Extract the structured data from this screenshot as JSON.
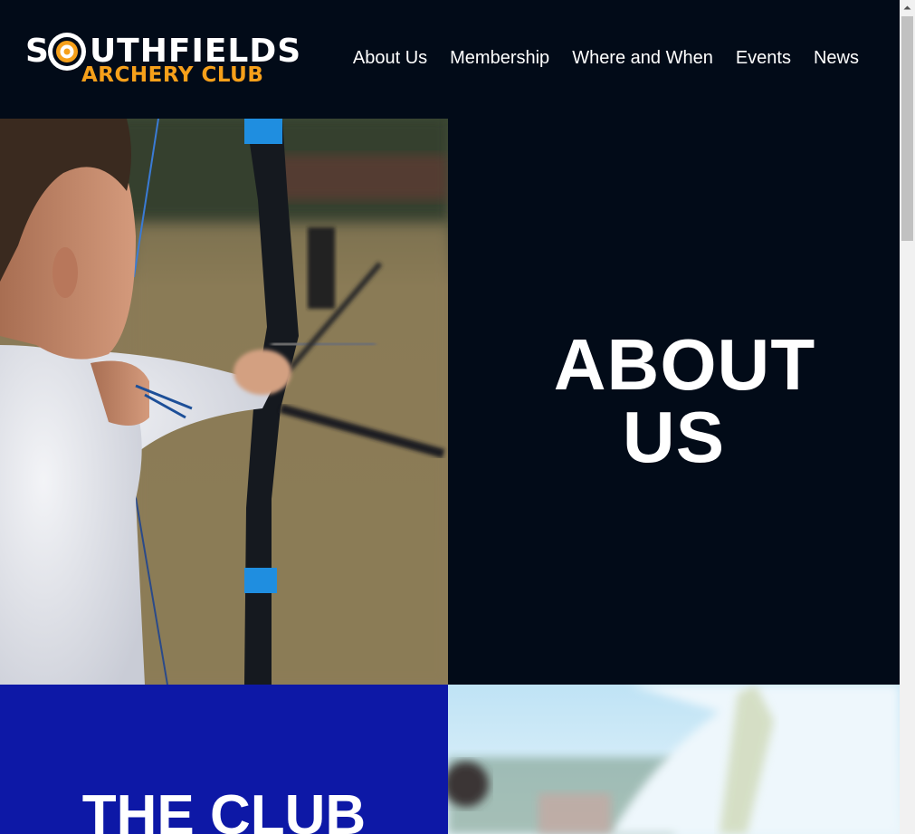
{
  "site": {
    "logo_line1": "SOUTHFIELDS",
    "logo_line1_lead": "S",
    "logo_line1_rest": "UTHFIELDS",
    "logo_line2": "ARCHERY CLUB"
  },
  "nav": {
    "items": [
      {
        "label": "About Us"
      },
      {
        "label": "Membership"
      },
      {
        "label": "Where and When"
      },
      {
        "label": "Events"
      },
      {
        "label": "News"
      }
    ]
  },
  "hero": {
    "title_line1": "ABOUT",
    "title_line2": "US"
  },
  "club_section": {
    "title": "THE CLUB"
  },
  "colors": {
    "navy": "#020b18",
    "brand_blue": "#0d18a6",
    "logo_orange": "#f6a01a"
  },
  "icons": [
    "archery-target-icon",
    "scroll-up-arrow-icon"
  ]
}
